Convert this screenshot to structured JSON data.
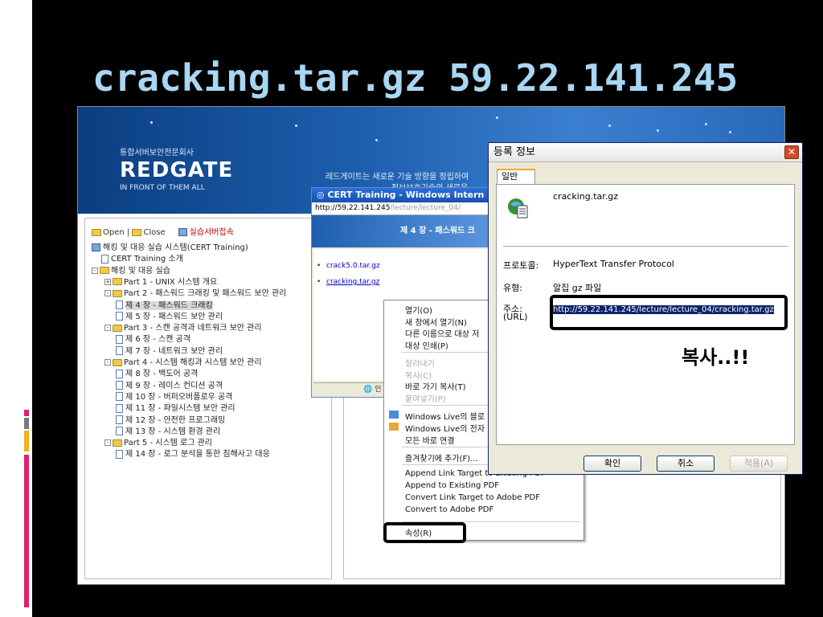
{
  "slide": {
    "title": "cracking.tar.gz 59.22.141.245"
  },
  "banner": {
    "org": "통합서버보안전문회사",
    "logo": "REDGATE",
    "tagline": "IN FRONT OF THEM ALL",
    "text1": "레드게이트는 새로운 기술 방향을 정립하여",
    "text2": "정보보호기술의 새로운"
  },
  "tree_toolbar": {
    "open": "Open",
    "sep": "|",
    "close": "Close",
    "server": "실습서버접속"
  },
  "tree": [
    {
      "label": "해킹 및 대응 실습 시스템(CERT Training)",
      "icon": "pc"
    },
    {
      "label": "CERT Training 소개",
      "icon": "doc"
    },
    {
      "label": "해킹 및 대응 실습",
      "icon": "folder",
      "pm": "-"
    },
    {
      "label": "Part 1 - UNIX 시스템 개요",
      "icon": "folder",
      "pm": "+"
    },
    {
      "label": "Part 2 - 패스워드 크래킹 및 패스워드 보안 관리",
      "icon": "folder",
      "pm": "-"
    },
    {
      "label": "제 4 장 - 패스워드 크래킹",
      "icon": "doc",
      "selected": true
    },
    {
      "label": "제 5 장 - 패스워드 보안 관리",
      "icon": "doc"
    },
    {
      "label": "Part 3 - 스캔 공격과 네트워크 보안 관리",
      "icon": "folder",
      "pm": "-"
    },
    {
      "label": "제 6 장 - 스캔 공격",
      "icon": "doc"
    },
    {
      "label": "제 7 장 - 네트워크 보안 관리",
      "icon": "doc"
    },
    {
      "label": "Part 4 - 시스템 해킹과 시스템 보안 관리",
      "icon": "folder",
      "pm": "-"
    },
    {
      "label": "제 8 장 - 백도어 공격",
      "icon": "doc"
    },
    {
      "label": "제 9 장 - 레이스 컨디션 공격",
      "icon": "doc"
    },
    {
      "label": "제 10 장 - 버퍼오버플로우 공격",
      "icon": "doc"
    },
    {
      "label": "제 11 장 - 파일시스템 보안 관리",
      "icon": "doc"
    },
    {
      "label": "제 12 장 - 안전한 프로그래밍",
      "icon": "doc"
    },
    {
      "label": "제 13 장 - 시스템 환경 관리",
      "icon": "doc"
    },
    {
      "label": "Part 5 - 시스템 로그 관리",
      "icon": "folder",
      "pm": "-"
    },
    {
      "label": "제 14 장 - 로그 분석을 통한 침해사고 대응",
      "icon": "doc"
    }
  ],
  "ie": {
    "title": "CERT Training - Windows Intern",
    "address": "http://59.22.141.245",
    "address_gray": "/lecture/lecture_04/",
    "banner": "제 4 장 - 패스워드 크",
    "links": [
      "crack5.0.tar.gz",
      "cracking.tar.gz"
    ],
    "status": "인"
  },
  "context_menu": {
    "items": [
      "열기(O)",
      "새 창에서 열기(N)",
      "다른 이름으로 대상 저",
      "대상 인쇄(P)",
      "잘라내기",
      "복사(C)",
      "바로 가기 복사(T)",
      "붙여넣기(P)",
      "Windows Live의 블로",
      "Windows Live의 전자",
      "모든 바로 연결",
      "즐겨찾기에 추가(F)...",
      "Append Link Target to Existing PDF",
      "Append to Existing PDF",
      "Convert Link Target to Adobe PDF",
      "Convert to Adobe PDF",
      "속성(R)"
    ]
  },
  "dialog": {
    "title": "등록 정보",
    "tab": "일반",
    "filename": "cracking.tar.gz",
    "protocol_label": "프로토콜:",
    "protocol_value": "HyperText Transfer Protocol",
    "type_label": "유형:",
    "type_value": "알집 gz 파일",
    "address_label": "주소:",
    "url_label": "(URL)",
    "url_value": "http://59.22.141.245/lecture/lecture_04/cracking.tar.gz",
    "annotation": "복사..!!",
    "ok": "확인",
    "cancel": "취소",
    "apply": "적용(A)"
  },
  "colors": {
    "title": "#a9d6f2",
    "accent_magenta": "#e0206b",
    "accent_yellow": "#f3b21c",
    "accent_gray": "#7a7a7a"
  }
}
